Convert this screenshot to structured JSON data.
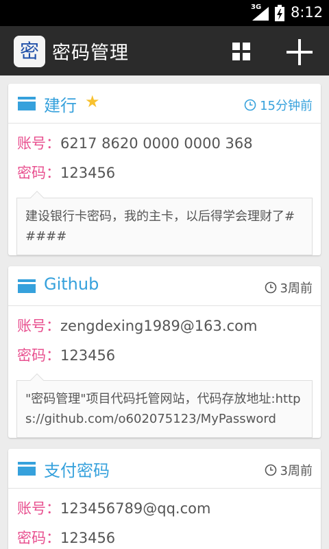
{
  "status_bar": {
    "network": "3G",
    "time": "8:12"
  },
  "action_bar": {
    "app_icon_char": "密",
    "title": "密码管理",
    "icons": [
      "grid-view-icon",
      "add-icon"
    ]
  },
  "colors": {
    "accent": "#36a1dc",
    "label": "#e8508f",
    "star": "#f8c12f",
    "actionbar_bg": "#2b2b2b"
  },
  "account_label": "账号：",
  "password_label": "密码：",
  "cards": [
    {
      "name": "建行",
      "starred": true,
      "time": "15分钟前",
      "account": "6217 8620 0000 0000 368",
      "password": "123456",
      "note": "建设银行卡密码，我的主卡，以后得学会理财了#####"
    },
    {
      "name": "Github",
      "starred": false,
      "time": "3周前",
      "account": "zengdexing1989@163.com",
      "password": "123456",
      "note": "\"密码管理\"项目代码托管网站，代码存放地址:https://github.com/o602075123/MyPassword"
    },
    {
      "name": "支付密码",
      "starred": false,
      "time": "3周前",
      "account": "123456789@qq.com",
      "password": "123456"
    }
  ]
}
